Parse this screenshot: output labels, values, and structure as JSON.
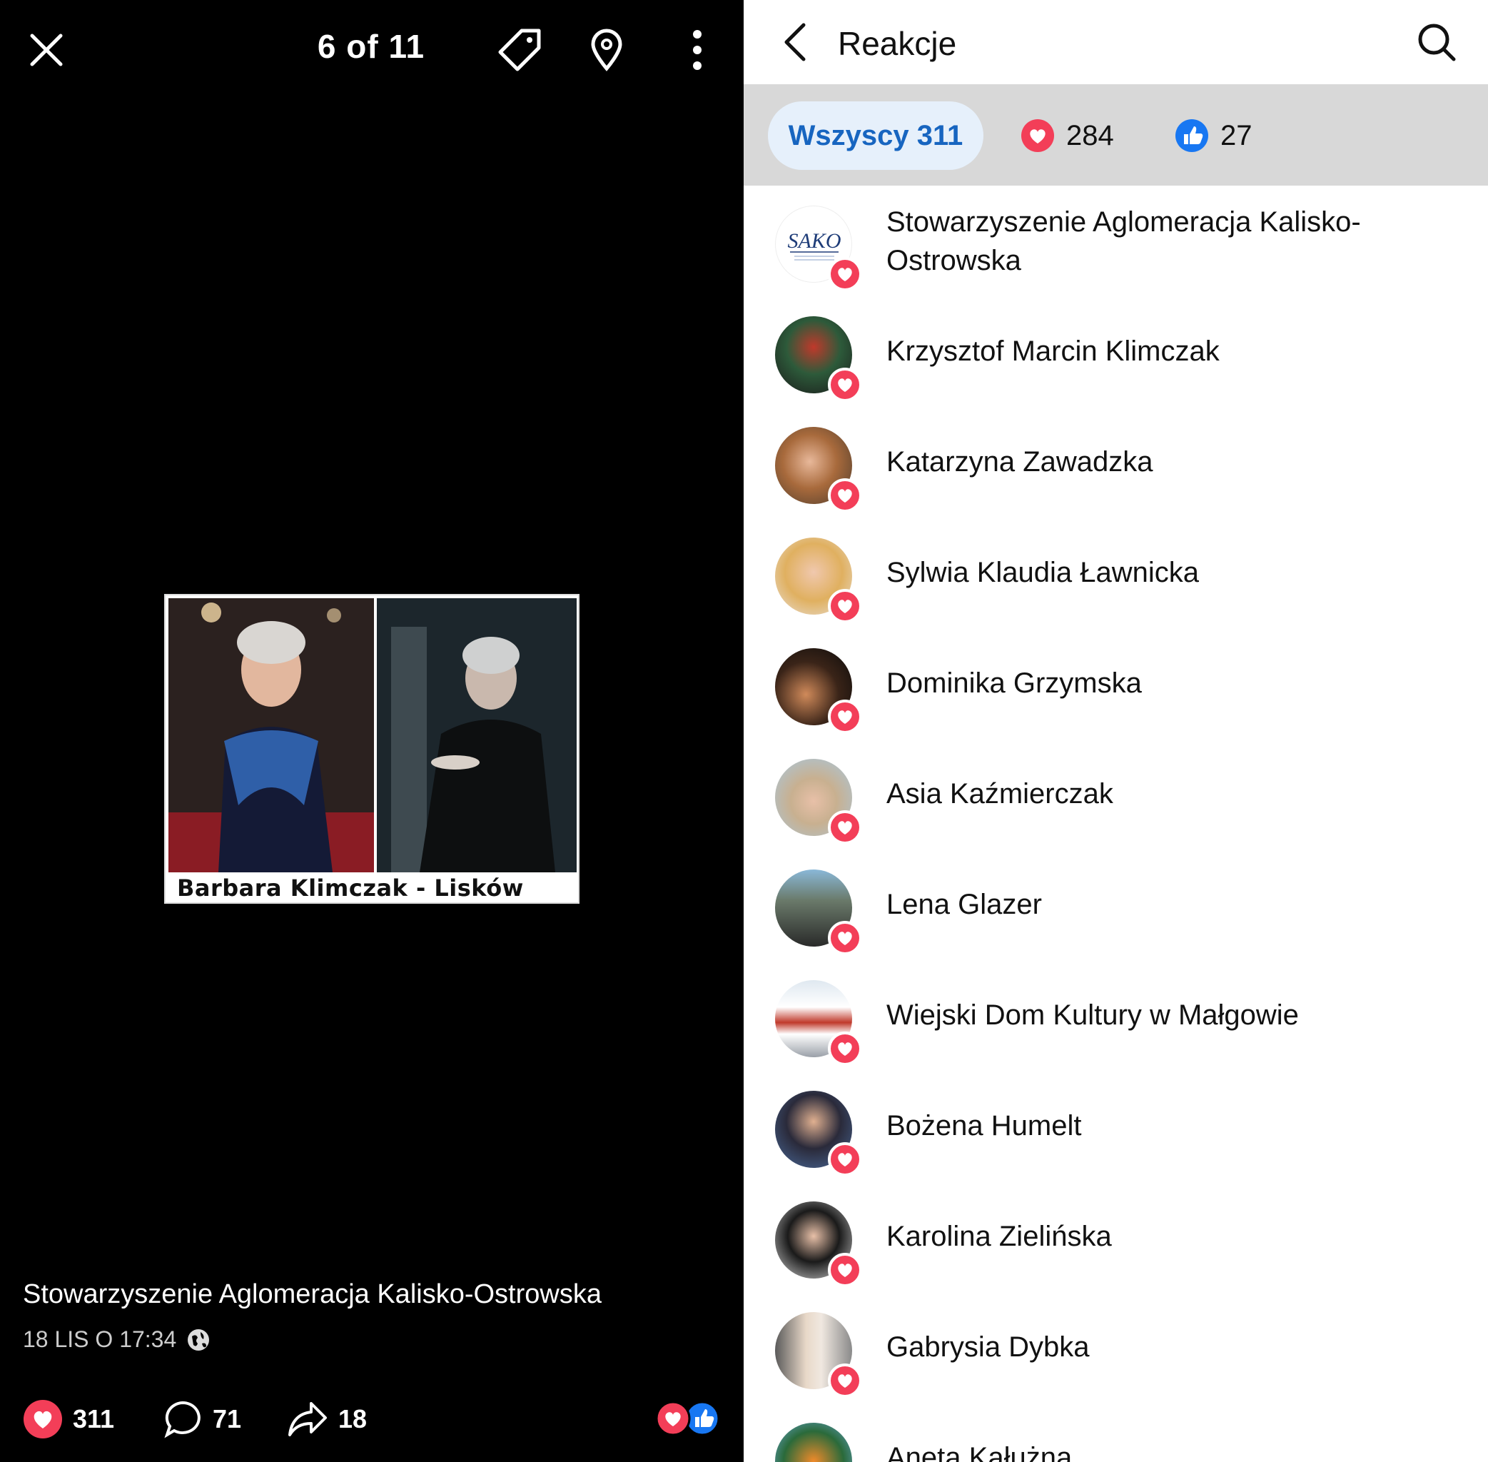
{
  "viewer": {
    "counter": "6 of 11",
    "caption": "Barbara Klimczak - Lisków",
    "author": "Stowarzyszenie Aglomeracja Kalisko-Ostrowska",
    "timestamp": "18 LIS O 17:34",
    "stats": {
      "reactions": "311",
      "comments": "71",
      "shares": "18"
    }
  },
  "panel": {
    "title": "Reakcje",
    "filters": {
      "all": "Wszyscy 311",
      "love": "284",
      "like": "27"
    },
    "people": [
      {
        "name": "Stowarzyszenie Aglomeracja Kalisko-Ostrowska",
        "avatar": "logo"
      },
      {
        "name": "Krzysztof Marcin Klimczak",
        "avatar": "c1"
      },
      {
        "name": "Katarzyna Zawadzka",
        "avatar": "c2"
      },
      {
        "name": "Sylwia Klaudia Ławnicka",
        "avatar": "c3"
      },
      {
        "name": "Dominika Grzymska",
        "avatar": "c4"
      },
      {
        "name": "Asia Kaźmierczak",
        "avatar": "c5"
      },
      {
        "name": "Lena Glazer",
        "avatar": "c6"
      },
      {
        "name": "Wiejski Dom Kultury w Małgowie",
        "avatar": "c7"
      },
      {
        "name": "Bożena Humelt",
        "avatar": "c8"
      },
      {
        "name": "Karolina Zielińska",
        "avatar": "c9"
      },
      {
        "name": "Gabrysia Dybka",
        "avatar": "c10"
      },
      {
        "name": "Aneta Kałużna",
        "avatar": "c11"
      }
    ]
  },
  "colors": {
    "love": "#f33e58",
    "like": "#1877f2",
    "chip_bg": "#e6f0fb",
    "chip_text": "#1765c0",
    "filter_bar": "#d8d8d8"
  },
  "logo_text": "SAKO"
}
